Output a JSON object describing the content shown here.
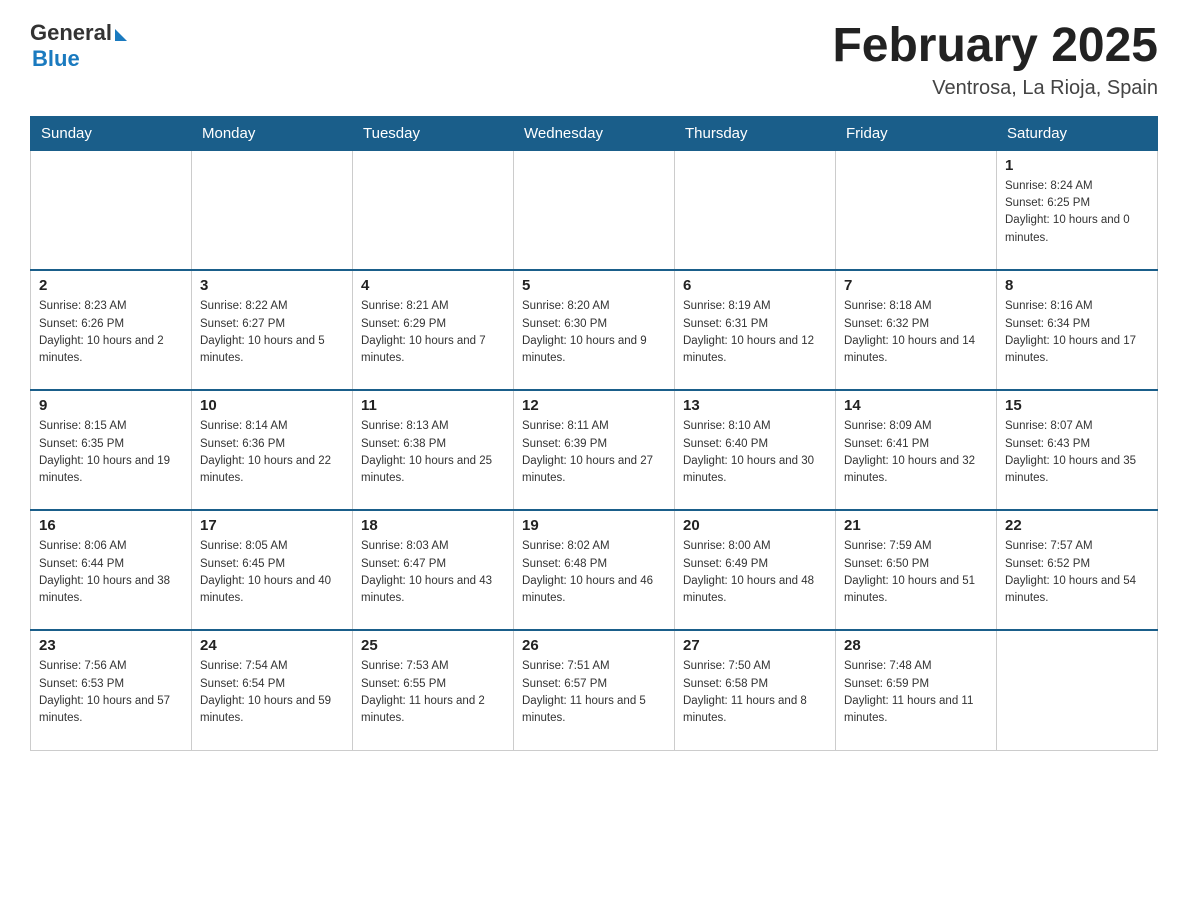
{
  "header": {
    "logo": {
      "general": "General",
      "blue": "Blue",
      "subtitle": "Blue"
    },
    "title": "February 2025",
    "location": "Ventrosa, La Rioja, Spain"
  },
  "days_of_week": [
    "Sunday",
    "Monday",
    "Tuesday",
    "Wednesday",
    "Thursday",
    "Friday",
    "Saturday"
  ],
  "weeks": [
    [
      {
        "day": "",
        "info": ""
      },
      {
        "day": "",
        "info": ""
      },
      {
        "day": "",
        "info": ""
      },
      {
        "day": "",
        "info": ""
      },
      {
        "day": "",
        "info": ""
      },
      {
        "day": "",
        "info": ""
      },
      {
        "day": "1",
        "info": "Sunrise: 8:24 AM\nSunset: 6:25 PM\nDaylight: 10 hours and 0 minutes."
      }
    ],
    [
      {
        "day": "2",
        "info": "Sunrise: 8:23 AM\nSunset: 6:26 PM\nDaylight: 10 hours and 2 minutes."
      },
      {
        "day": "3",
        "info": "Sunrise: 8:22 AM\nSunset: 6:27 PM\nDaylight: 10 hours and 5 minutes."
      },
      {
        "day": "4",
        "info": "Sunrise: 8:21 AM\nSunset: 6:29 PM\nDaylight: 10 hours and 7 minutes."
      },
      {
        "day": "5",
        "info": "Sunrise: 8:20 AM\nSunset: 6:30 PM\nDaylight: 10 hours and 9 minutes."
      },
      {
        "day": "6",
        "info": "Sunrise: 8:19 AM\nSunset: 6:31 PM\nDaylight: 10 hours and 12 minutes."
      },
      {
        "day": "7",
        "info": "Sunrise: 8:18 AM\nSunset: 6:32 PM\nDaylight: 10 hours and 14 minutes."
      },
      {
        "day": "8",
        "info": "Sunrise: 8:16 AM\nSunset: 6:34 PM\nDaylight: 10 hours and 17 minutes."
      }
    ],
    [
      {
        "day": "9",
        "info": "Sunrise: 8:15 AM\nSunset: 6:35 PM\nDaylight: 10 hours and 19 minutes."
      },
      {
        "day": "10",
        "info": "Sunrise: 8:14 AM\nSunset: 6:36 PM\nDaylight: 10 hours and 22 minutes."
      },
      {
        "day": "11",
        "info": "Sunrise: 8:13 AM\nSunset: 6:38 PM\nDaylight: 10 hours and 25 minutes."
      },
      {
        "day": "12",
        "info": "Sunrise: 8:11 AM\nSunset: 6:39 PM\nDaylight: 10 hours and 27 minutes."
      },
      {
        "day": "13",
        "info": "Sunrise: 8:10 AM\nSunset: 6:40 PM\nDaylight: 10 hours and 30 minutes."
      },
      {
        "day": "14",
        "info": "Sunrise: 8:09 AM\nSunset: 6:41 PM\nDaylight: 10 hours and 32 minutes."
      },
      {
        "day": "15",
        "info": "Sunrise: 8:07 AM\nSunset: 6:43 PM\nDaylight: 10 hours and 35 minutes."
      }
    ],
    [
      {
        "day": "16",
        "info": "Sunrise: 8:06 AM\nSunset: 6:44 PM\nDaylight: 10 hours and 38 minutes."
      },
      {
        "day": "17",
        "info": "Sunrise: 8:05 AM\nSunset: 6:45 PM\nDaylight: 10 hours and 40 minutes."
      },
      {
        "day": "18",
        "info": "Sunrise: 8:03 AM\nSunset: 6:47 PM\nDaylight: 10 hours and 43 minutes."
      },
      {
        "day": "19",
        "info": "Sunrise: 8:02 AM\nSunset: 6:48 PM\nDaylight: 10 hours and 46 minutes."
      },
      {
        "day": "20",
        "info": "Sunrise: 8:00 AM\nSunset: 6:49 PM\nDaylight: 10 hours and 48 minutes."
      },
      {
        "day": "21",
        "info": "Sunrise: 7:59 AM\nSunset: 6:50 PM\nDaylight: 10 hours and 51 minutes."
      },
      {
        "day": "22",
        "info": "Sunrise: 7:57 AM\nSunset: 6:52 PM\nDaylight: 10 hours and 54 minutes."
      }
    ],
    [
      {
        "day": "23",
        "info": "Sunrise: 7:56 AM\nSunset: 6:53 PM\nDaylight: 10 hours and 57 minutes."
      },
      {
        "day": "24",
        "info": "Sunrise: 7:54 AM\nSunset: 6:54 PM\nDaylight: 10 hours and 59 minutes."
      },
      {
        "day": "25",
        "info": "Sunrise: 7:53 AM\nSunset: 6:55 PM\nDaylight: 11 hours and 2 minutes."
      },
      {
        "day": "26",
        "info": "Sunrise: 7:51 AM\nSunset: 6:57 PM\nDaylight: 11 hours and 5 minutes."
      },
      {
        "day": "27",
        "info": "Sunrise: 7:50 AM\nSunset: 6:58 PM\nDaylight: 11 hours and 8 minutes."
      },
      {
        "day": "28",
        "info": "Sunrise: 7:48 AM\nSunset: 6:59 PM\nDaylight: 11 hours and 11 minutes."
      },
      {
        "day": "",
        "info": ""
      }
    ]
  ]
}
